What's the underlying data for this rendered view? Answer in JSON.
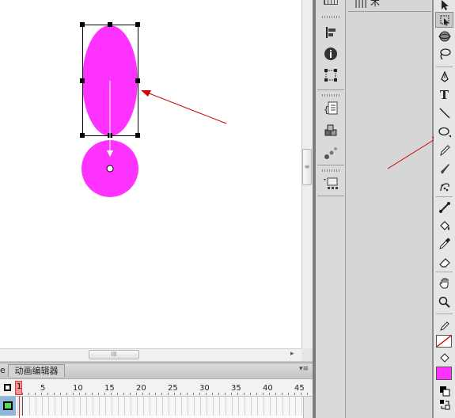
{
  "timeline": {
    "tab_label": "动画编辑器",
    "left_tab_fragment": "e",
    "frame_number": "1",
    "ticks": [
      "5",
      "10",
      "15",
      "20",
      "25",
      "30",
      "35",
      "40",
      "45"
    ],
    "menu_glyph": "▾≡"
  },
  "stage": {
    "fill_color": "#ff33ff",
    "arrow_color": "#cc0000"
  },
  "scroll": {
    "h_grip": "III",
    "v_grip": "≡",
    "right_arrow": "▸"
  },
  "panel": {
    "top_label_fragment": "|||| 术"
  },
  "tools": {
    "text_tool_glyph": "T",
    "fill_swatch_color": "#ff33ff"
  }
}
